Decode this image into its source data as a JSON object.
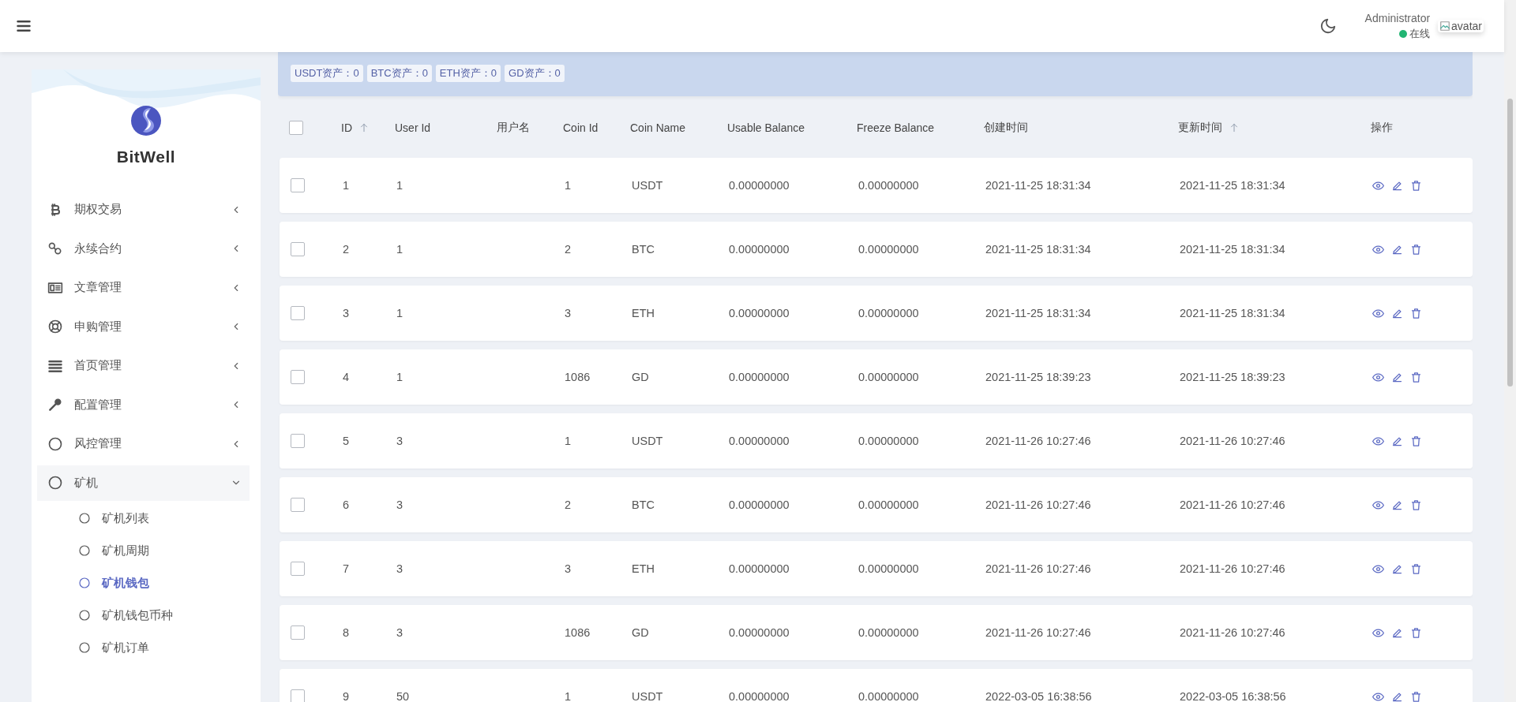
{
  "header": {
    "user": {
      "name": "Administrator",
      "status": "在线",
      "online": true,
      "avatar_alt": "avatar"
    }
  },
  "sidebar": {
    "brand": "BitWell",
    "items": [
      {
        "label": "期权交易",
        "expanded": false
      },
      {
        "label": "永续合约",
        "expanded": false
      },
      {
        "label": "文章管理",
        "expanded": false
      },
      {
        "label": "申购管理",
        "expanded": false
      },
      {
        "label": "首页管理",
        "expanded": false
      },
      {
        "label": "配置管理",
        "expanded": false
      },
      {
        "label": "风控管理",
        "expanded": false
      },
      {
        "label": "矿机",
        "expanded": true,
        "children": [
          {
            "label": "矿机列表",
            "selected": false
          },
          {
            "label": "矿机周期",
            "selected": false
          },
          {
            "label": "矿机钱包",
            "selected": true
          },
          {
            "label": "矿机钱包币种",
            "selected": false
          },
          {
            "label": "矿机订单",
            "selected": false
          }
        ]
      }
    ]
  },
  "stats": [
    "USDT资产：0",
    "BTC资产：0",
    "ETH资产：0",
    "GD资产：0"
  ],
  "table": {
    "select_all": {
      "checked": false
    },
    "columns": [
      {
        "label": "ID",
        "sort_arrow": true
      },
      {
        "label": "User Id",
        "sort_arrow": false
      },
      {
        "label": "用户名",
        "sort_arrow": false
      },
      {
        "label": "Coin Id",
        "sort_arrow": false
      },
      {
        "label": "Coin Name",
        "sort_arrow": false
      },
      {
        "label": "Usable Balance",
        "sort_arrow": false
      },
      {
        "label": "Freeze Balance",
        "sort_arrow": false
      },
      {
        "label": "创建时间",
        "sort_arrow": false
      },
      {
        "label": "更新时间",
        "sort_arrow": true
      },
      {
        "label": "操作",
        "sort_arrow": false
      }
    ],
    "rows": [
      {
        "checked": false,
        "id": "1",
        "user_id": "1",
        "coin_id": "1",
        "coin_name": "USDT",
        "usable_balance": "0.00000000",
        "freeze_balance": "0.00000000",
        "created_at": "2021-11-25 18:31:34",
        "updated_at": "2021-11-25 18:31:34"
      },
      {
        "checked": false,
        "id": "2",
        "user_id": "1",
        "coin_id": "2",
        "coin_name": "BTC",
        "usable_balance": "0.00000000",
        "freeze_balance": "0.00000000",
        "created_at": "2021-11-25 18:31:34",
        "updated_at": "2021-11-25 18:31:34"
      },
      {
        "checked": false,
        "id": "3",
        "user_id": "1",
        "coin_id": "3",
        "coin_name": "ETH",
        "usable_balance": "0.00000000",
        "freeze_balance": "0.00000000",
        "created_at": "2021-11-25 18:31:34",
        "updated_at": "2021-11-25 18:31:34"
      },
      {
        "checked": false,
        "id": "4",
        "user_id": "1",
        "coin_id": "1086",
        "coin_name": "GD",
        "usable_balance": "0.00000000",
        "freeze_balance": "0.00000000",
        "created_at": "2021-11-25 18:39:23",
        "updated_at": "2021-11-25 18:39:23"
      },
      {
        "checked": false,
        "id": "5",
        "user_id": "3",
        "coin_id": "1",
        "coin_name": "USDT",
        "usable_balance": "0.00000000",
        "freeze_balance": "0.00000000",
        "created_at": "2021-11-26 10:27:46",
        "updated_at": "2021-11-26 10:27:46"
      },
      {
        "checked": false,
        "id": "6",
        "user_id": "3",
        "coin_id": "2",
        "coin_name": "BTC",
        "usable_balance": "0.00000000",
        "freeze_balance": "0.00000000",
        "created_at": "2021-11-26 10:27:46",
        "updated_at": "2021-11-26 10:27:46"
      },
      {
        "checked": false,
        "id": "7",
        "user_id": "3",
        "coin_id": "3",
        "coin_name": "ETH",
        "usable_balance": "0.00000000",
        "freeze_balance": "0.00000000",
        "created_at": "2021-11-26 10:27:46",
        "updated_at": "2021-11-26 10:27:46"
      },
      {
        "checked": false,
        "id": "8",
        "user_id": "3",
        "coin_id": "1086",
        "coin_name": "GD",
        "usable_balance": "0.00000000",
        "freeze_balance": "0.00000000",
        "created_at": "2021-11-26 10:27:46",
        "updated_at": "2021-11-26 10:27:46"
      },
      {
        "checked": false,
        "id": "9",
        "user_id": "50",
        "coin_id": "1",
        "coin_name": "USDT",
        "usable_balance": "0.00000000",
        "freeze_balance": "0.00000000",
        "created_at": "2022-03-05 16:38:56",
        "updated_at": "2022-03-05 16:38:56"
      }
    ]
  }
}
